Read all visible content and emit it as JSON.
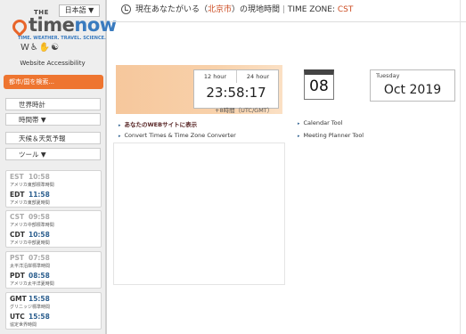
{
  "sidebar": {
    "language": "日本語 ▼",
    "logo": {
      "the": "THE",
      "name_a": "time",
      "name_b": "now",
      "tagline": "TIME. WEATHER. TRAVEL. SCIENCE."
    },
    "accessibility_icons": "W♿✋☯",
    "accessibility_label": "Website Accessibility",
    "search_placeholder": "都市/国を検索...",
    "nav": [
      {
        "label": "世界時計"
      },
      {
        "label": "時間帯 ▼"
      },
      {
        "label": "天候＆天気予報"
      },
      {
        "label": "ツール ▼"
      }
    ],
    "tz_groups": [
      [
        {
          "abbr": "EST",
          "time": "10:58",
          "name": "アメリカ東部標準時間",
          "dim": true
        },
        {
          "abbr": "EDT",
          "time": "11:58",
          "name": "アメリカ東部夏時間",
          "dim": false
        }
      ],
      [
        {
          "abbr": "CST",
          "time": "09:58",
          "name": "アメリカ中部標準時間",
          "dim": true
        },
        {
          "abbr": "CDT",
          "time": "10:58",
          "name": "アメリカ中部夏時間",
          "dim": false
        }
      ],
      [
        {
          "abbr": "PST",
          "time": "07:58",
          "name": "太平洋沿岸標準時間",
          "dim": true
        },
        {
          "abbr": "PDT",
          "time": "08:58",
          "name": "アメリカ太平洋夏時間",
          "dim": false
        }
      ],
      [
        {
          "abbr": "GMT",
          "time": "15:58",
          "name": "グリニッジ標準時間",
          "dim": false
        },
        {
          "abbr": "UTC",
          "time": "15:58",
          "name": "協定世界時間",
          "dim": false
        }
      ]
    ]
  },
  "header": {
    "prefix": "現在あなたがいる（",
    "city": "北京市",
    "suffix": "）の現地時間",
    "sep": "|",
    "tz_label": "TIME ZONE:",
    "tz_value": "CST"
  },
  "clock": {
    "tab_12": "12 hour",
    "tab_24": "24 hour",
    "time": "23:58:17",
    "offset": "+8時間（UTC/GMT）"
  },
  "calendar": {
    "day": "08"
  },
  "date": {
    "weekday": "Tuesday",
    "month_year": "Oct 2019"
  },
  "links": {
    "left": [
      {
        "label": "あなたのWEBサイトに表示",
        "bold": true
      },
      {
        "label": "Convert Times & Time Zone Converter",
        "bold": false
      }
    ],
    "right": [
      {
        "label": "Calendar Tool"
      },
      {
        "label": "Meeting Planner Tool"
      }
    ]
  }
}
